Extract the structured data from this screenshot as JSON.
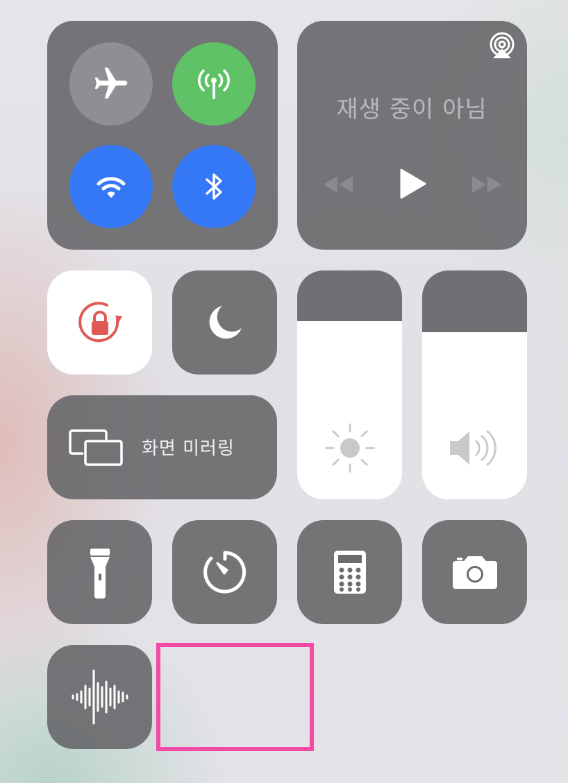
{
  "connectivity": {
    "airplane": {
      "label": "airplane-mode",
      "state": "off",
      "color": "#8e8e93"
    },
    "cellular": {
      "label": "cellular-data",
      "state": "on",
      "color": "#5fc266"
    },
    "wifi": {
      "label": "wifi",
      "state": "on",
      "color": "#3478f6"
    },
    "bluetooth": {
      "label": "bluetooth",
      "state": "on",
      "color": "#3478f6"
    }
  },
  "media": {
    "title": "재생 중이 아님",
    "controls": [
      "rewind",
      "play",
      "fast-forward"
    ]
  },
  "screen_mirroring": {
    "label": "화면 미러링"
  },
  "orientation_lock": {
    "state": "on",
    "color": "#e05a55"
  },
  "do_not_disturb": {
    "state": "off"
  },
  "brightness": {
    "level": 0.78
  },
  "volume": {
    "level": 0.73
  },
  "shortcuts": [
    "flashlight",
    "timer",
    "calculator",
    "camera",
    "voice-memos"
  ]
}
